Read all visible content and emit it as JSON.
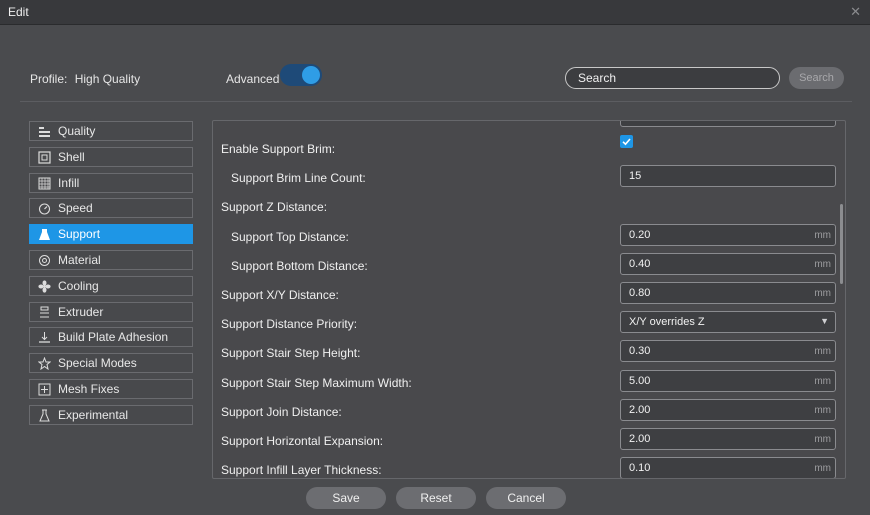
{
  "window": {
    "title": "Edit"
  },
  "header": {
    "profile_label": "Profile:",
    "profile_value": "High Quality",
    "advanced_label": "Advanced",
    "advanced_on": true,
    "search_placeholder": "Search",
    "search_button": "Search"
  },
  "categories": [
    {
      "label": "Quality",
      "icon": "quality-icon",
      "active": false
    },
    {
      "label": "Shell",
      "icon": "shell-icon",
      "active": false
    },
    {
      "label": "Infill",
      "icon": "infill-icon",
      "active": false
    },
    {
      "label": "Speed",
      "icon": "speed-icon",
      "active": false
    },
    {
      "label": "Support",
      "icon": "support-icon",
      "active": true
    },
    {
      "label": "Material",
      "icon": "material-icon",
      "active": false
    },
    {
      "label": "Cooling",
      "icon": "cooling-icon",
      "active": false
    },
    {
      "label": "Extruder",
      "icon": "extruder-icon",
      "active": false
    },
    {
      "label": "Build Plate Adhesion",
      "icon": "build-plate-icon",
      "active": false
    },
    {
      "label": "Special Modes",
      "icon": "special-modes-icon",
      "active": false
    },
    {
      "label": "Mesh Fixes",
      "icon": "mesh-fixes-icon",
      "active": false
    },
    {
      "label": "Experimental",
      "icon": "experimental-icon",
      "active": false
    }
  ],
  "settings": [
    {
      "label": "Enable Support Brim:",
      "type": "checkbox",
      "checked": true
    },
    {
      "label": "Support Brim Line Count:",
      "type": "number",
      "value": "15",
      "unit": ""
    },
    {
      "label": "Support Z Distance:",
      "type": "header"
    },
    {
      "label": "Support Top Distance:",
      "type": "number",
      "value": "0.20",
      "unit": "mm"
    },
    {
      "label": "Support Bottom Distance:",
      "type": "number",
      "value": "0.40",
      "unit": "mm"
    },
    {
      "label": "Support X/Y Distance:",
      "type": "number",
      "value": "0.80",
      "unit": "mm"
    },
    {
      "label": "Support Distance Priority:",
      "type": "select",
      "value": "X/Y overrides Z"
    },
    {
      "label": "Support Stair Step Height:",
      "type": "number",
      "value": "0.30",
      "unit": "mm"
    },
    {
      "label": "Support Stair Step Maximum Width:",
      "type": "number",
      "value": "5.00",
      "unit": "mm"
    },
    {
      "label": "Support Join Distance:",
      "type": "number",
      "value": "2.00",
      "unit": "mm"
    },
    {
      "label": "Support Horizontal Expansion:",
      "type": "number",
      "value": "2.00",
      "unit": "mm"
    },
    {
      "label": "Support Infill Layer Thickness:",
      "type": "number",
      "value": "0.10",
      "unit": "mm"
    }
  ],
  "footer": {
    "save": "Save",
    "reset": "Reset",
    "cancel": "Cancel"
  },
  "colors": {
    "accent": "#1e96e6",
    "background": "#4a4b4e",
    "titlebar": "#38393c"
  }
}
